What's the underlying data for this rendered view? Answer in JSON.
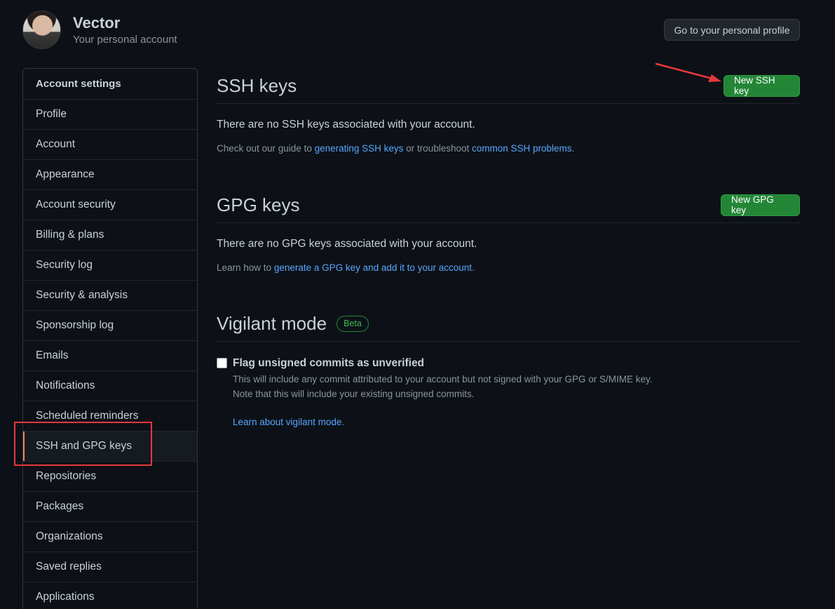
{
  "header": {
    "account_name": "Vector",
    "account_subtitle": "Your personal account",
    "profile_button": "Go to your personal profile"
  },
  "sidebar": {
    "heading": "Account settings",
    "items": [
      {
        "label": "Profile"
      },
      {
        "label": "Account"
      },
      {
        "label": "Appearance"
      },
      {
        "label": "Account security"
      },
      {
        "label": "Billing & plans"
      },
      {
        "label": "Security log"
      },
      {
        "label": "Security & analysis"
      },
      {
        "label": "Sponsorship log"
      },
      {
        "label": "Emails"
      },
      {
        "label": "Notifications"
      },
      {
        "label": "Scheduled reminders"
      },
      {
        "label": "SSH and GPG keys",
        "selected": true
      },
      {
        "label": "Repositories"
      },
      {
        "label": "Packages"
      },
      {
        "label": "Organizations"
      },
      {
        "label": "Saved replies"
      },
      {
        "label": "Applications"
      }
    ]
  },
  "ssh": {
    "title": "SSH keys",
    "new_button": "New SSH key",
    "empty_text": "There are no SSH keys associated with your account.",
    "help_prefix": "Check out our guide to ",
    "help_link1": "generating SSH keys",
    "help_middle": " or troubleshoot ",
    "help_link2": "common SSH problems",
    "help_suffix": "."
  },
  "gpg": {
    "title": "GPG keys",
    "new_button": "New GPG key",
    "empty_text": "There are no GPG keys associated with your account.",
    "help_prefix": "Learn how to ",
    "help_link": "generate a GPG key and add it to your account",
    "help_suffix": "."
  },
  "vigilant": {
    "title": "Vigilant mode",
    "badge": "Beta",
    "checkbox_label": "Flag unsigned commits as unverified",
    "checked": false,
    "desc_line1": "This will include any commit attributed to your account but not signed with your GPG or S/MIME key.",
    "desc_line2": "Note that this will include your existing unsigned commits.",
    "learn_link": "Learn about vigilant mode",
    "learn_suffix": "."
  },
  "colors": {
    "background": "#0d1117",
    "accent_green": "#238636",
    "link_blue": "#58a6ff",
    "annotation_red": "#e5393b",
    "selected_marker": "#f78166"
  }
}
